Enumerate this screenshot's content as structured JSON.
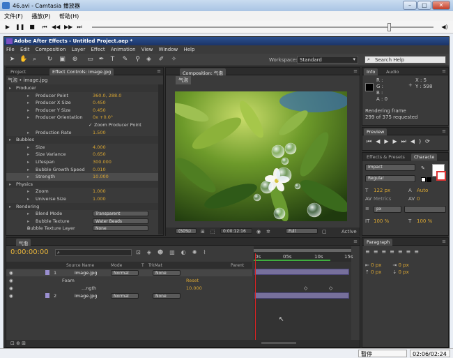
{
  "player": {
    "window_title": "46.avi - Camtasia 播放器",
    "menu": [
      "文件(F)",
      "播放(P)",
      "帮助(H)"
    ],
    "status": "暂停",
    "time": "02:06/02:24"
  },
  "ae": {
    "title": "Adobe After Effects - Untitled Project.aep *",
    "menu": [
      "File",
      "Edit",
      "Composition",
      "Layer",
      "Effect",
      "Animation",
      "View",
      "Window",
      "Help"
    ],
    "workspace_label": "Workspace:",
    "workspace": "Standard",
    "search_placeholder": "Search Help"
  },
  "effects": {
    "tab_project": "Project",
    "tab_controls": "Effect Controls: image.jpg",
    "layer_path": "气泡 • image.jpg",
    "rows": [
      {
        "label": "Producer",
        "value": ""
      },
      {
        "label": "Producer Point",
        "value": "360.0, 288.0"
      },
      {
        "label": "Producer X Size",
        "value": "0.450"
      },
      {
        "label": "Producer Y Size",
        "value": "0.450"
      },
      {
        "label": "Producer Orientation",
        "value": "0x +0.0°"
      },
      {
        "label": "Zoom Producer Point",
        "value": ""
      },
      {
        "label": "Production Rate",
        "value": "1.500"
      },
      {
        "label": "Bubbles",
        "value": ""
      },
      {
        "label": "Size",
        "value": "4.000"
      },
      {
        "label": "Size Variance",
        "value": "0.650"
      },
      {
        "label": "Lifespan",
        "value": "300.000"
      },
      {
        "label": "Bubble Growth Speed",
        "value": "0.010"
      },
      {
        "label": "Strength",
        "value": "10.000"
      },
      {
        "label": "Physics",
        "value": ""
      },
      {
        "label": "Zoom",
        "value": "1.000"
      },
      {
        "label": "Universe Size",
        "value": "1.000"
      },
      {
        "label": "Rendering",
        "value": ""
      },
      {
        "label": "Blend Mode",
        "value": "Transparent"
      },
      {
        "label": "Bubble Texture",
        "value": "Water Beads"
      },
      {
        "label": "Bubble Texture Layer",
        "value": "None"
      }
    ]
  },
  "comp": {
    "tab": "Composition: 气泡",
    "crumb": "气泡",
    "zoom": "(50%)",
    "timecode": "0:00:12:16",
    "quality": "Full",
    "active": "Active"
  },
  "info": {
    "tab_info": "Info",
    "tab_audio": "Audio",
    "r": "R :",
    "g": "G :",
    "b": "B :",
    "a": "A : 0",
    "x": "X : 5",
    "y": "Y : 598",
    "render1": "Rendering frame",
    "render2": "299 of 375 requested"
  },
  "preview": {
    "tab": "Preview"
  },
  "chars": {
    "tab_effects": "Effects & Presets",
    "tab_char": "Characte",
    "font": "Impact",
    "style": "Regular",
    "size": "122 px",
    "auto": "Auto",
    "metrics": "Metrics",
    "zero": "0",
    "px": "px",
    "pct1": "100 %",
    "pct2": "100 %"
  },
  "timeline": {
    "tab": "气泡",
    "timecode": "0:00:00:00",
    "cols": [
      "Source Name",
      "Mode",
      "T",
      "TrkMat",
      "Parent"
    ],
    "markers": [
      "0s",
      "05s",
      "10s",
      "15s"
    ],
    "layers": [
      {
        "num": "1",
        "name": "image.jpg",
        "mode": "Normal",
        "trk": "None"
      },
      {
        "num": "",
        "name": "Foam",
        "mode": "",
        "trk": "",
        "reset": "Reset"
      },
      {
        "num": "",
        "name": "...ngth",
        "mode": "",
        "trk": "",
        "val": "10.000"
      },
      {
        "num": "2",
        "name": "image.jpg",
        "mode": "Normal",
        "trk": "None"
      }
    ]
  },
  "paragraph": {
    "tab": "Paragraph",
    "px": "0 px"
  }
}
